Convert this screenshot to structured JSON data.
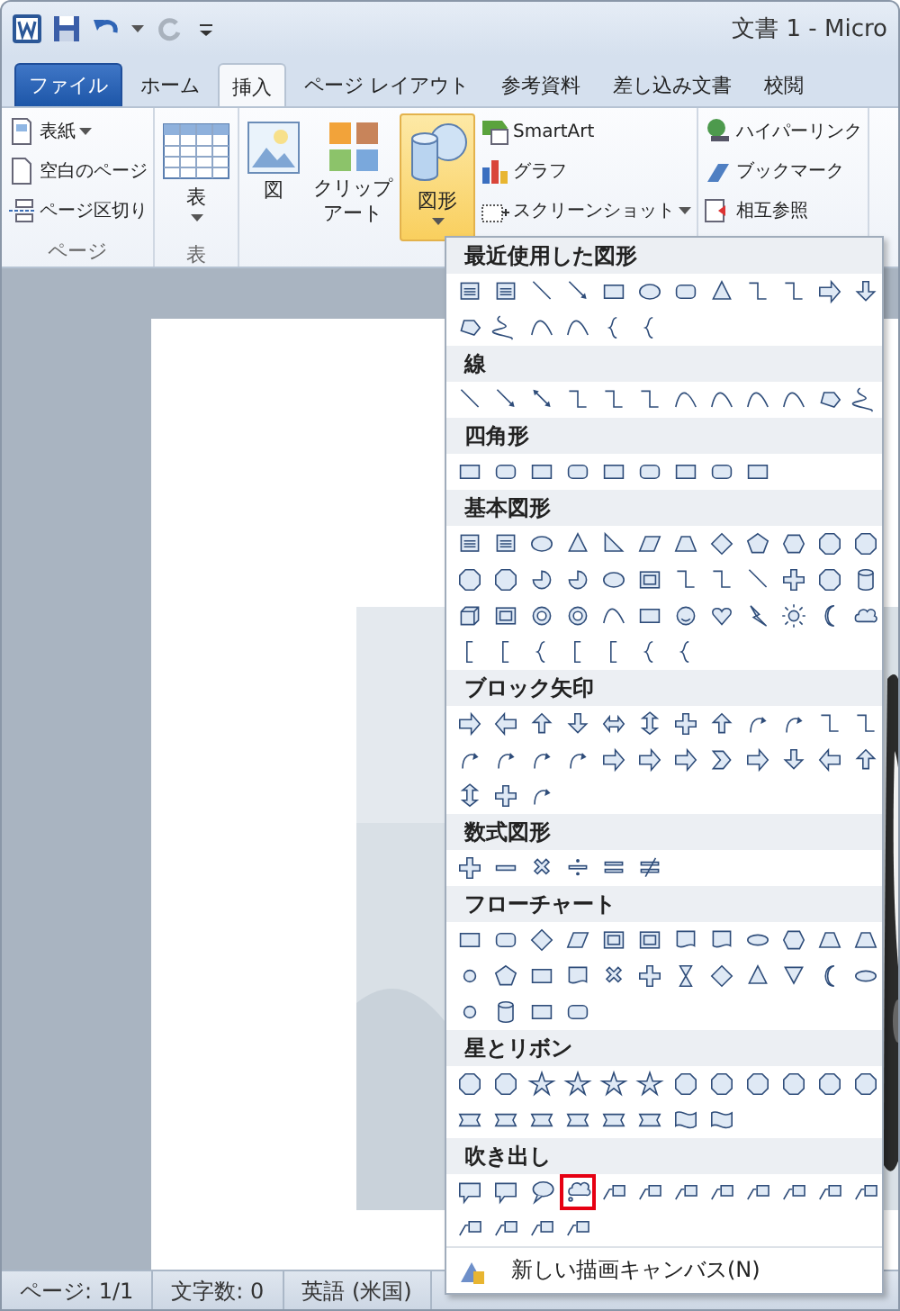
{
  "window": {
    "title": "文書 1 - Micro"
  },
  "tabs": [
    {
      "label": "ファイル",
      "kind": "file",
      "selected": false
    },
    {
      "label": "ホーム",
      "kind": "tab",
      "selected": false
    },
    {
      "label": "挿入",
      "kind": "tab",
      "selected": true
    },
    {
      "label": "ページ レイアウト",
      "kind": "tab",
      "selected": false
    },
    {
      "label": "参考資料",
      "kind": "tab",
      "selected": false
    },
    {
      "label": "差し込み文書",
      "kind": "tab",
      "selected": false
    },
    {
      "label": "校閲",
      "kind": "tab",
      "selected": false
    }
  ],
  "ribbon": [
    {
      "label": "ページ",
      "buttons": [
        {
          "kind": "small",
          "label": "表紙",
          "dropdown": true,
          "pressed": false
        },
        {
          "kind": "small",
          "label": "空白のページ",
          "dropdown": false,
          "pressed": false
        },
        {
          "kind": "small",
          "label": "ページ区切り",
          "dropdown": false,
          "pressed": false
        }
      ]
    },
    {
      "label": "表",
      "buttons": [
        {
          "kind": "large",
          "label": "表",
          "dropdown": true,
          "pressed": false
        }
      ]
    },
    {
      "buttons": [
        {
          "kind": "large",
          "label": "図",
          "dropdown": false,
          "pressed": false
        },
        {
          "kind": "large",
          "label": "クリップアート",
          "dropdown": false,
          "pressed": false
        },
        {
          "kind": "large",
          "label": "図形",
          "dropdown": true,
          "pressed": true
        },
        {
          "kind": "small",
          "label": "SmartArt",
          "dropdown": false,
          "pressed": false
        },
        {
          "kind": "small",
          "label": "グラフ",
          "dropdown": false,
          "pressed": false
        },
        {
          "kind": "small",
          "label": "スクリーンショット",
          "dropdown": true,
          "pressed": false
        }
      ]
    },
    {
      "buttons": [
        {
          "kind": "small",
          "label": "ハイパーリンク",
          "pressed": false
        },
        {
          "kind": "small",
          "label": "ブックマーク",
          "pressed": false
        },
        {
          "kind": "small",
          "label": "相互参照",
          "pressed": false
        }
      ]
    }
  ],
  "shapes_menu": {
    "sections": [
      {
        "title": "最近使用した図形",
        "shapes": [
          {
            "kind": "text-box",
            "selected": false
          },
          {
            "kind": "text-box",
            "selected": false
          },
          {
            "kind": "line",
            "selected": false
          },
          {
            "kind": "arrow",
            "selected": false
          },
          {
            "kind": "rectangle",
            "selected": false
          },
          {
            "kind": "ellipse",
            "selected": false
          },
          {
            "kind": "rounded-rectangle",
            "selected": false
          },
          {
            "kind": "triangle",
            "selected": false
          },
          {
            "kind": "elbow-connector",
            "selected": false
          },
          {
            "kind": "elbow-connector",
            "selected": false
          },
          {
            "kind": "block-arrow",
            "selected": false
          },
          {
            "kind": "down-arrow",
            "selected": false
          },
          {
            "kind": "freeform",
            "selected": false
          },
          {
            "kind": "scribble",
            "selected": false
          },
          {
            "kind": "arc",
            "selected": false
          },
          {
            "kind": "curve",
            "selected": false
          },
          {
            "kind": "brace",
            "selected": false
          },
          {
            "kind": "brace",
            "selected": false
          }
        ]
      },
      {
        "title": "線",
        "shapes": [
          {
            "kind": "line",
            "selected": false
          },
          {
            "kind": "arrow",
            "selected": false
          },
          {
            "kind": "double-arrow",
            "selected": false
          },
          {
            "kind": "elbow-connector",
            "selected": false
          },
          {
            "kind": "elbow-connector",
            "selected": false
          },
          {
            "kind": "elbow-connector",
            "selected": false
          },
          {
            "kind": "curve",
            "selected": false
          },
          {
            "kind": "curve",
            "selected": false
          },
          {
            "kind": "curve",
            "selected": false
          },
          {
            "kind": "arc",
            "selected": false
          },
          {
            "kind": "freeform",
            "selected": false
          },
          {
            "kind": "scribble",
            "selected": false
          }
        ]
      },
      {
        "title": "四角形",
        "shapes": [
          {
            "kind": "rectangle",
            "selected": false
          },
          {
            "kind": "rounded-rectangle",
            "selected": false
          },
          {
            "kind": "rectangle",
            "selected": false
          },
          {
            "kind": "rounded-rectangle",
            "selected": false
          },
          {
            "kind": "rectangle",
            "selected": false
          },
          {
            "kind": "rounded-rectangle",
            "selected": false
          },
          {
            "kind": "rectangle",
            "selected": false
          },
          {
            "kind": "rounded-rectangle",
            "selected": false
          },
          {
            "kind": "rectangle",
            "selected": false
          }
        ]
      },
      {
        "title": "基本図形",
        "shapes": [
          {
            "kind": "text-box",
            "selected": false
          },
          {
            "kind": "text-box",
            "selected": false
          },
          {
            "kind": "ellipse",
            "selected": false
          },
          {
            "kind": "triangle",
            "selected": false
          },
          {
            "kind": "right-triangle",
            "selected": false
          },
          {
            "kind": "parallelogram",
            "selected": false
          },
          {
            "kind": "trapezoid",
            "selected": false
          },
          {
            "kind": "diamond",
            "selected": false
          },
          {
            "kind": "pentagon",
            "selected": false
          },
          {
            "kind": "hexagon",
            "selected": false
          },
          {
            "kind": "octagon",
            "selected": false
          },
          {
            "kind": "octagon",
            "selected": false
          },
          {
            "kind": "octagon",
            "selected": false
          },
          {
            "kind": "octagon",
            "selected": false
          },
          {
            "kind": "pie",
            "selected": false
          },
          {
            "kind": "pie",
            "selected": false
          },
          {
            "kind": "ellipse",
            "selected": false
          },
          {
            "kind": "frame",
            "selected": false
          },
          {
            "kind": "elbow-connector",
            "selected": false
          },
          {
            "kind": "elbow-connector",
            "selected": false
          },
          {
            "kind": "line",
            "selected": false
          },
          {
            "kind": "plus",
            "selected": false
          },
          {
            "kind": "octagon",
            "selected": false
          },
          {
            "kind": "cylinder",
            "selected": false
          },
          {
            "kind": "cube",
            "selected": false
          },
          {
            "kind": "frame",
            "selected": false
          },
          {
            "kind": "donut",
            "selected": false
          },
          {
            "kind": "donut",
            "selected": false
          },
          {
            "kind": "arc",
            "selected": false
          },
          {
            "kind": "rectangle",
            "selected": false
          },
          {
            "kind": "smiley",
            "selected": false
          },
          {
            "kind": "heart",
            "selected": false
          },
          {
            "kind": "lightning",
            "selected": false
          },
          {
            "kind": "sun",
            "selected": false
          },
          {
            "kind": "moon",
            "selected": false
          },
          {
            "kind": "cloud",
            "selected": false
          },
          {
            "kind": "bracket",
            "selected": false
          },
          {
            "kind": "bracket",
            "selected": false
          },
          {
            "kind": "brace",
            "selected": false
          },
          {
            "kind": "bracket",
            "selected": false
          },
          {
            "kind": "bracket",
            "selected": false
          },
          {
            "kind": "brace",
            "selected": false
          },
          {
            "kind": "brace",
            "selected": false
          }
        ]
      },
      {
        "title": "ブロック矢印",
        "shapes": [
          {
            "kind": "block-arrow",
            "selected": false
          },
          {
            "kind": "left-arrow",
            "selected": false
          },
          {
            "kind": "up-arrow",
            "selected": false
          },
          {
            "kind": "down-arrow",
            "selected": false
          },
          {
            "kind": "left-right-arrow",
            "selected": false
          },
          {
            "kind": "up-down-arrow",
            "selected": false
          },
          {
            "kind": "quad-arrow",
            "selected": false
          },
          {
            "kind": "up-arrow",
            "selected": false
          },
          {
            "kind": "curved-arrow",
            "selected": false
          },
          {
            "kind": "curved-arrow",
            "selected": false
          },
          {
            "kind": "elbow-connector",
            "selected": false
          },
          {
            "kind": "elbow-connector",
            "selected": false
          },
          {
            "kind": "curved-arrow",
            "selected": false
          },
          {
            "kind": "curved-arrow",
            "selected": false
          },
          {
            "kind": "curved-arrow",
            "selected": false
          },
          {
            "kind": "curved-arrow",
            "selected": false
          },
          {
            "kind": "block-arrow",
            "selected": false
          },
          {
            "kind": "block-arrow",
            "selected": false
          },
          {
            "kind": "pentagon-arrow",
            "selected": false
          },
          {
            "kind": "chevron",
            "selected": false
          },
          {
            "kind": "block-arrow",
            "selected": false
          },
          {
            "kind": "down-arrow",
            "selected": false
          },
          {
            "kind": "left-arrow",
            "selected": false
          },
          {
            "kind": "up-arrow",
            "selected": false
          },
          {
            "kind": "up-down-arrow",
            "selected": false
          },
          {
            "kind": "quad-arrow",
            "selected": false
          },
          {
            "kind": "curved-arrow",
            "selected": false
          }
        ]
      },
      {
        "title": "数式図形",
        "shapes": [
          {
            "kind": "plus",
            "selected": false
          },
          {
            "kind": "minus",
            "selected": false
          },
          {
            "kind": "multiply",
            "selected": false
          },
          {
            "kind": "divide",
            "selected": false
          },
          {
            "kind": "equals",
            "selected": false
          },
          {
            "kind": "not-equal",
            "selected": false
          }
        ]
      },
      {
        "title": "フローチャート",
        "shapes": [
          {
            "kind": "rectangle",
            "selected": false
          },
          {
            "kind": "rounded-rectangle",
            "selected": false
          },
          {
            "kind": "diamond",
            "selected": false
          },
          {
            "kind": "parallelogram",
            "selected": false
          },
          {
            "kind": "frame",
            "selected": false
          },
          {
            "kind": "frame",
            "selected": false
          },
          {
            "kind": "document",
            "selected": false
          },
          {
            "kind": "document",
            "selected": false
          },
          {
            "kind": "stadium",
            "selected": false
          },
          {
            "kind": "hexagon",
            "selected": false
          },
          {
            "kind": "trapezoid",
            "selected": false
          },
          {
            "kind": "trapezoid",
            "selected": false
          },
          {
            "kind": "circle",
            "selected": false
          },
          {
            "kind": "pentagon",
            "selected": false
          },
          {
            "kind": "rectangle",
            "selected": false
          },
          {
            "kind": "document",
            "selected": false
          },
          {
            "kind": "multiply",
            "selected": false
          },
          {
            "kind": "plus",
            "selected": false
          },
          {
            "kind": "hourglass",
            "selected": false
          },
          {
            "kind": "diamond",
            "selected": false
          },
          {
            "kind": "triangle",
            "selected": false
          },
          {
            "kind": "down-triangle",
            "selected": false
          },
          {
            "kind": "moon",
            "selected": false
          },
          {
            "kind": "stadium",
            "selected": false
          },
          {
            "kind": "circle",
            "selected": false
          },
          {
            "kind": "cylinder",
            "selected": false
          },
          {
            "kind": "rectangle",
            "selected": false
          },
          {
            "kind": "rounded-rectangle",
            "selected": false
          }
        ]
      },
      {
        "title": "星とリボン",
        "shapes": [
          {
            "kind": "burst",
            "selected": false
          },
          {
            "kind": "burst",
            "selected": false
          },
          {
            "kind": "star",
            "selected": false
          },
          {
            "kind": "star",
            "selected": false
          },
          {
            "kind": "star",
            "selected": false
          },
          {
            "kind": "star",
            "selected": false
          },
          {
            "kind": "burst",
            "selected": false
          },
          {
            "kind": "burst",
            "selected": false
          },
          {
            "kind": "burst",
            "selected": false
          },
          {
            "kind": "burst",
            "selected": false
          },
          {
            "kind": "burst",
            "selected": false
          },
          {
            "kind": "burst",
            "selected": false
          },
          {
            "kind": "ribbon",
            "selected": false
          },
          {
            "kind": "ribbon",
            "selected": false
          },
          {
            "kind": "ribbon",
            "selected": false
          },
          {
            "kind": "ribbon",
            "selected": false
          },
          {
            "kind": "scroll",
            "selected": false
          },
          {
            "kind": "scroll",
            "selected": false
          },
          {
            "kind": "wave",
            "selected": false
          },
          {
            "kind": "wave",
            "selected": false
          }
        ]
      },
      {
        "title": "吹き出し",
        "shapes": [
          {
            "kind": "callout",
            "selected": false
          },
          {
            "kind": "callout",
            "selected": false
          },
          {
            "kind": "oval-callout",
            "selected": false
          },
          {
            "kind": "cloud-callout",
            "selected": true
          },
          {
            "kind": "line-callout",
            "selected": false
          },
          {
            "kind": "line-callout",
            "selected": false
          },
          {
            "kind": "line-callout",
            "selected": false
          },
          {
            "kind": "line-callout",
            "selected": false
          },
          {
            "kind": "line-callout",
            "selected": false
          },
          {
            "kind": "line-callout",
            "selected": false
          },
          {
            "kind": "line-callout",
            "selected": false
          },
          {
            "kind": "line-callout",
            "selected": false
          },
          {
            "kind": "line-callout",
            "selected": false
          },
          {
            "kind": "line-callout",
            "selected": false
          },
          {
            "kind": "line-callout",
            "selected": false
          },
          {
            "kind": "line-callout",
            "selected": false
          }
        ]
      }
    ],
    "footer": {
      "label": "新しい描画キャンバス(N)"
    }
  },
  "status_bar": [
    {
      "text": "ページ: 1/1"
    },
    {
      "text": "文字数: 0"
    },
    {
      "text": "英語 (米国)"
    }
  ]
}
